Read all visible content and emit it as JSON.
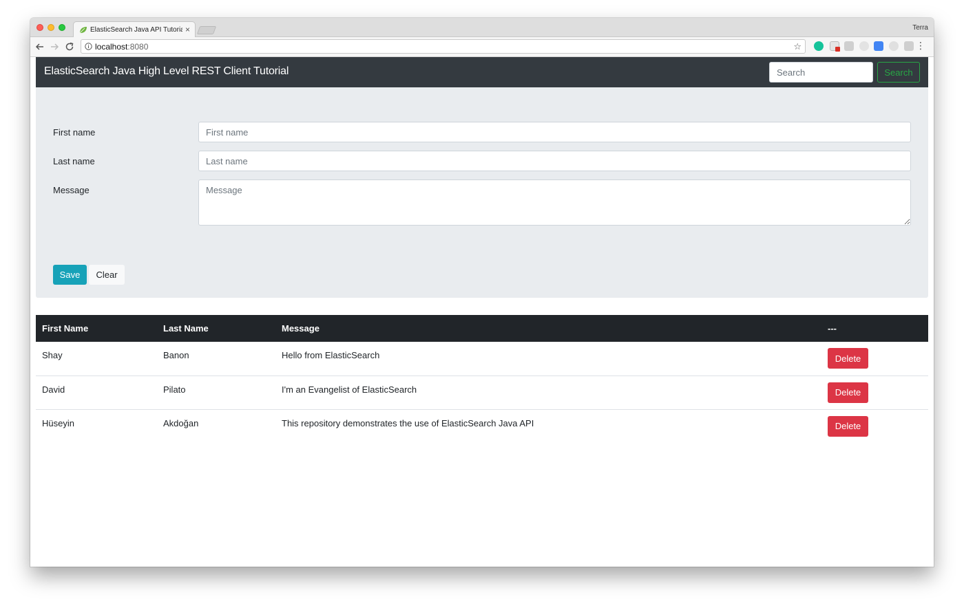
{
  "browser": {
    "tab_title": "ElasticSearch Java API Tutorial",
    "tab_close": "×",
    "profile_name": "Terra",
    "url_host": "localhost",
    "url_port": ":8080",
    "bookmark_star": "☆",
    "menu_dots": "⋮"
  },
  "navbar": {
    "brand": "ElasticSearch Java High Level REST Client Tutorial",
    "search_placeholder": "Search",
    "search_button": "Search"
  },
  "form": {
    "first_name_label": "First name",
    "first_name_placeholder": "First name",
    "last_name_label": "Last name",
    "last_name_placeholder": "Last name",
    "message_label": "Message",
    "message_placeholder": "Message",
    "save_label": "Save",
    "clear_label": "Clear"
  },
  "table": {
    "headers": [
      "First Name",
      "Last Name",
      "Message",
      "---"
    ],
    "delete_label": "Delete",
    "rows": [
      {
        "first": "Shay",
        "last": "Banon",
        "message": "Hello from ElasticSearch"
      },
      {
        "first": "David",
        "last": "Pilato",
        "message": "I'm an Evangelist of ElasticSearch"
      },
      {
        "first": "Hüseyin",
        "last": "Akdoğan",
        "message": "This repository demonstrates the use of ElasticSearch Java API"
      }
    ]
  },
  "colors": {
    "navbar_bg": "#343a40",
    "jumbotron_bg": "#e9ecef",
    "save_btn": "#17a2b8",
    "delete_btn": "#dc3545",
    "search_btn": "#28a745",
    "table_header_bg": "#212529"
  }
}
